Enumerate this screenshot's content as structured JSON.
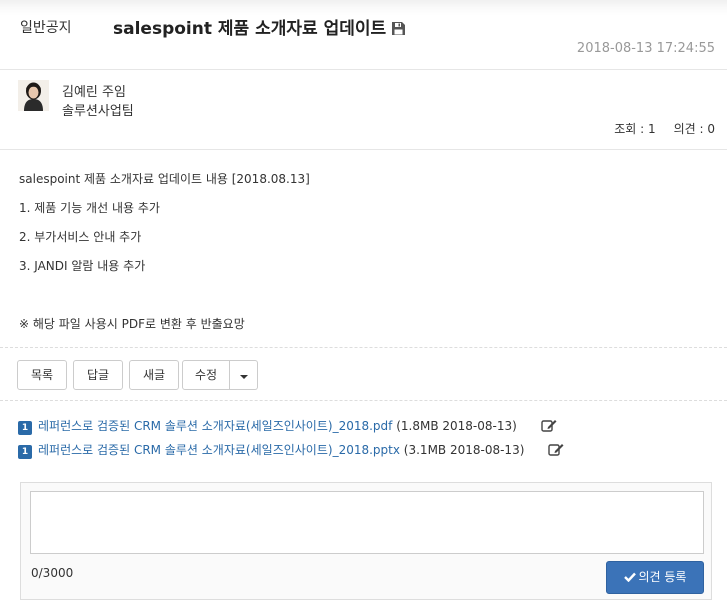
{
  "header": {
    "category": "일반공지",
    "title": "salespoint 제품 소개자료 업데이트",
    "title_icon": "save-icon",
    "datetime": "2018-08-13 17:24:55"
  },
  "author": {
    "name": "김예린 주임",
    "team": "솔루션사업팀",
    "views_label": "조회 : 1",
    "comments_label": "의견 : 0"
  },
  "content": {
    "lines": [
      "salespoint 제품 소개자료 업데이트 내용 [2018.08.13]",
      "1. 제품 기능 개선 내용 추가",
      "2. 부가서비스 안내 추가",
      "3. JANDI 알람 내용 추가",
      "",
      "※ 해당 파일 사용시 PDF로 변환 후 반출요망"
    ]
  },
  "actions": {
    "list": "목록",
    "reply": "답글",
    "new": "새글",
    "edit": "수정"
  },
  "attachments": [
    {
      "badge": "1",
      "name": "레퍼런스로 검증된 CRM 솔루션 소개자료(세일즈인사이트)_2018.pdf",
      "meta": "(1.8MB 2018-08-13)"
    },
    {
      "badge": "1",
      "name": "레퍼런스로 검증된 CRM 솔루션 소개자료(세일즈인사이트)_2018.pptx",
      "meta": "(3.1MB 2018-08-13)"
    }
  ],
  "comment": {
    "value": "",
    "counter": "0/3000",
    "submit_label": "의견 등록"
  },
  "colors": {
    "accent": "#3b73b8",
    "link": "#2a6aa8"
  }
}
